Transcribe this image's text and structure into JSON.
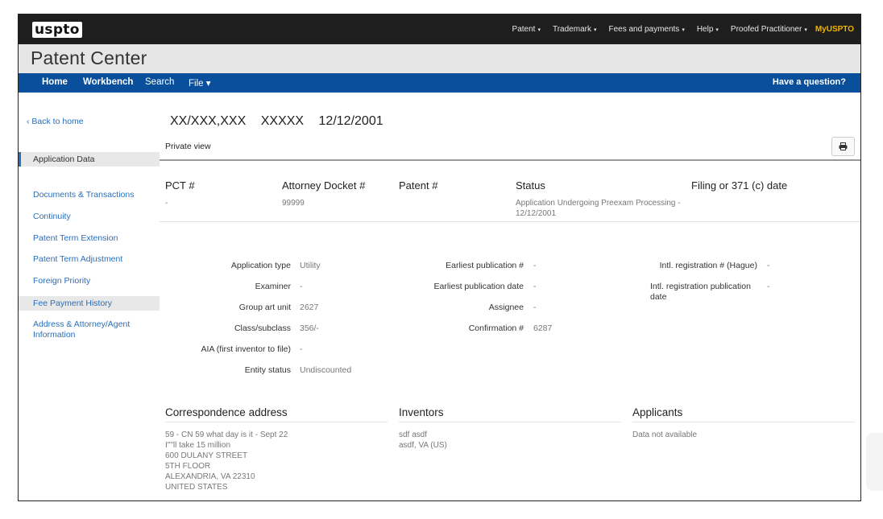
{
  "topbar": {
    "logo": "uspto",
    "nav": [
      {
        "label": "Patent",
        "caret": "▾"
      },
      {
        "label": "Trademark",
        "caret": "▾"
      },
      {
        "label": "Fees and payments",
        "caret": "▾"
      },
      {
        "label": "Help",
        "caret": "▾"
      },
      {
        "label": "Proofed Practitioner",
        "caret": "▾"
      }
    ],
    "myuspto": "MyUSPTO"
  },
  "title": "Patent Center",
  "bluenav": {
    "home": "Home",
    "workbench": "Workbench",
    "search": "Search",
    "file": "File",
    "file_caret": "▾",
    "question": "Have a question?"
  },
  "sidebar": {
    "back": "‹ Back to home",
    "items": [
      "Application Data",
      "Documents & Transactions",
      "Continuity",
      "Patent Term Extension",
      "Patent Term Adjustment",
      "Foreign Priority",
      "Fee Payment History",
      "Address & Attorney/Agent Information"
    ]
  },
  "application": {
    "number": "XX/XXX,XXX",
    "name": "XXXXX",
    "date": "12/12/2001",
    "view": "Private view"
  },
  "summary": {
    "pct_label": "PCT #",
    "pct_value": "-",
    "docket_label": "Attorney Docket #",
    "docket_value": "99999",
    "patent_label": "Patent #",
    "patent_value": "",
    "status_label": "Status",
    "status_value": "Application Undergoing Preexam Processing - 12/12/2001",
    "filing_label": "Filing or 371 (c) date",
    "filing_value": "-"
  },
  "details": {
    "app_type_label": "Application type",
    "app_type_value": "Utility",
    "examiner_label": "Examiner",
    "examiner_value": "-",
    "art_unit_label": "Group art unit",
    "art_unit_value": "2627",
    "class_label": "Class/subclass",
    "class_value": "356/-",
    "aia_label": "AIA (first inventor to file)",
    "aia_value": "-",
    "entity_label": "Entity status",
    "entity_value": "Undiscounted",
    "earliest_pub_label": "Earliest publication #",
    "earliest_pub_value": "-",
    "earliest_pub_date_label": "Earliest publication date",
    "earliest_pub_date_value": "-",
    "assignee_label": "Assignee",
    "assignee_value": "-",
    "confirmation_label": "Confirmation #",
    "confirmation_value": "6287",
    "intl_reg_label": "Intl. registration # (Hague)",
    "intl_reg_value": "-",
    "intl_pub_date_label": "Intl. registration publication date",
    "intl_pub_date_value": "-"
  },
  "sections": {
    "correspondence_title": "Correspondence address",
    "correspondence_value": "59 - CN 59 what day is it - Sept 22\nI\"\"ll take 15 million\n600 DULANY STREET\n5TH FLOOR\nALEXANDRIA, VA 22310\nUNITED STATES",
    "inventors_title": "Inventors",
    "inventors_value": "sdf asdf\nasdf, VA (US)",
    "applicants_title": "Applicants",
    "applicants_value": "Data not available"
  }
}
